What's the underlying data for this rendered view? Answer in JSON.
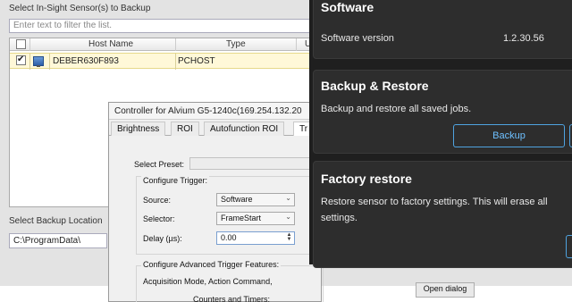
{
  "backup_window": {
    "sensors_label": "Select In-Sight Sensor(s) to Backup",
    "filter_placeholder": "Enter text to filter the list.",
    "columns": [
      "Host Name",
      "Type",
      "U"
    ],
    "rows": [
      {
        "checked": true,
        "host_name": "DEBER630F893",
        "type": "PCHOST"
      }
    ],
    "location_label": "Select Backup Location",
    "location_path": "C:\\ProgramData\\"
  },
  "controller": {
    "title": "Controller for Alvium G5-1240c(169.254.132.20",
    "tabs": [
      "Brightness",
      "ROI",
      "Autofunction ROI",
      "Tr"
    ],
    "select_preset_label": "Select Preset:",
    "configure_trigger_label": "Configure Trigger:",
    "source_label": "Source:",
    "source_value": "Software",
    "selector_label": "Selector:",
    "selector_value": "FrameStart",
    "delay_label": "Delay (µs):",
    "delay_value": "0.00",
    "advanced_label": "Configure Advanced Trigger Features:",
    "advanced_line1": "Acquisition Mode, Action Command,",
    "advanced_line2": "Counters and Timers:",
    "open_dialog_label": "Open dialog"
  },
  "settings": {
    "software": {
      "title": "Software",
      "version_label": "Software version",
      "version_value": "1.2.30.56"
    },
    "backup_restore": {
      "title": "Backup & Restore",
      "description": "Backup and restore all saved jobs.",
      "backup_button": "Backup"
    },
    "factory_restore": {
      "title": "Factory restore",
      "description_line1": "Restore sensor to factory settings. This will erase all",
      "description_line2": "settings."
    },
    "accent_color": "#4fa3e0"
  }
}
